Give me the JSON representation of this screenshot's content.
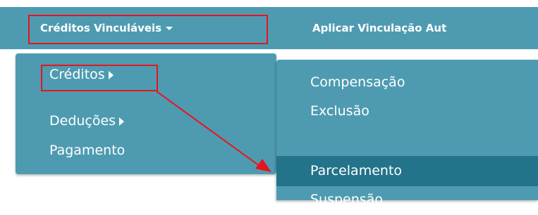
{
  "navbar": {
    "items": [
      {
        "label": "Créditos Vinculáveis"
      },
      {
        "label": "Aplicar Vinculação Aut"
      }
    ]
  },
  "dropdown": {
    "items": [
      {
        "label": "Créditos"
      },
      {
        "label": "Deduções"
      },
      {
        "label": "Pagamento"
      }
    ]
  },
  "submenu": {
    "items": [
      {
        "label": "Compensação"
      },
      {
        "label": "Exclusão"
      },
      {
        "label": "Parcelamento"
      },
      {
        "label": "Suspensão"
      }
    ],
    "active_item": "Parcelamento"
  },
  "colors": {
    "menu_bg": "#4e9bb1",
    "active_bg": "#23738a",
    "annotation_red": "#e8131e"
  }
}
